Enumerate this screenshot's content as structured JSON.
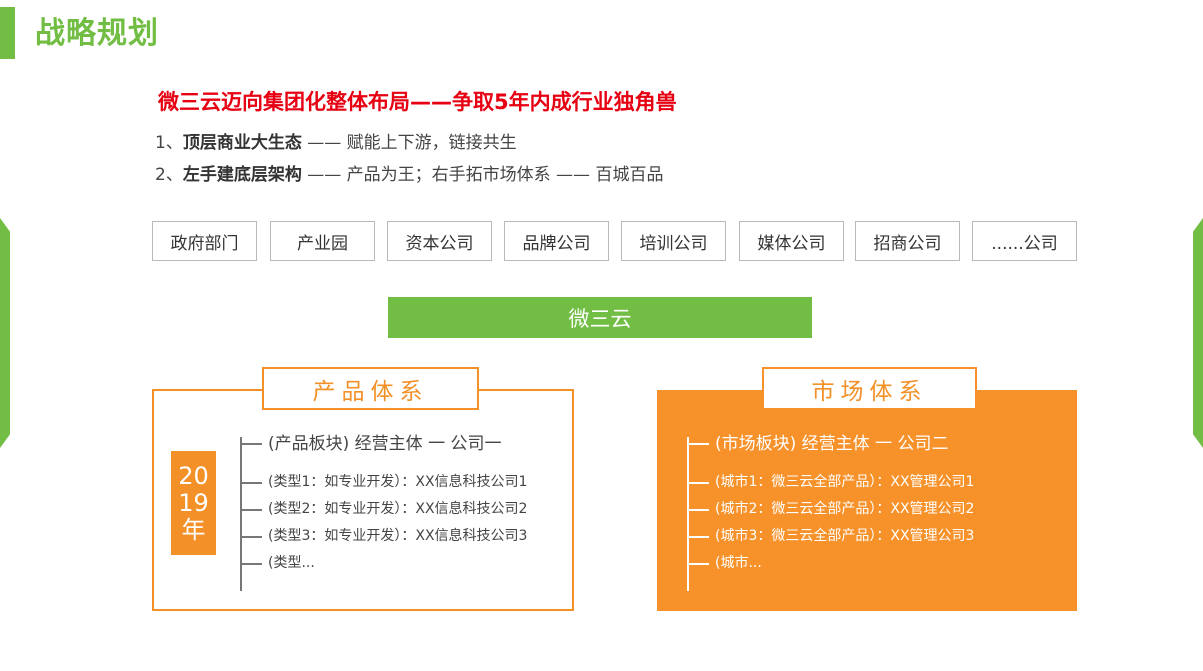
{
  "header": {
    "title": "战略规划"
  },
  "headline": "微三云迈向集团化整体布局——争取5年内成行业独角兽",
  "points": [
    {
      "prefix": "1、",
      "bold": "顶层商业大生态",
      "rest": " —— 赋能上下游，链接共生"
    },
    {
      "prefix": "2、",
      "bold": "左手建底层架构",
      "rest": " —— 产品为王；右手拓市场体系 —— 百城百品"
    }
  ],
  "tags": [
    "政府部门",
    "产业园",
    "资本公司",
    "品牌公司",
    "培训公司",
    "媒体公司",
    "招商公司",
    "......公司"
  ],
  "center": "微三云",
  "product": {
    "title": "产品体系",
    "year_lines": [
      "20",
      "19",
      "年"
    ],
    "main": "(产品板块) 经营主体 一 公司一",
    "items": [
      "(类型1：如专业开发）：XX信息科技公司1",
      "(类型2：如专业开发）：XX信息科技公司2",
      "(类型3：如专业开发）：XX信息科技公司3",
      "(类型..."
    ]
  },
  "market": {
    "title": "市场体系",
    "main": "(市场板块) 经营主体 一 公司二",
    "items": [
      "(城市1：微三云全部产品）：XX管理公司1",
      "(城市2：微三云全部产品）：XX管理公司2",
      "(城市3：微三云全部产品）：XX管理公司3",
      "(城市..."
    ]
  },
  "colors": {
    "green": "#72bd43",
    "orange": "#f39027",
    "red": "#e60012"
  }
}
